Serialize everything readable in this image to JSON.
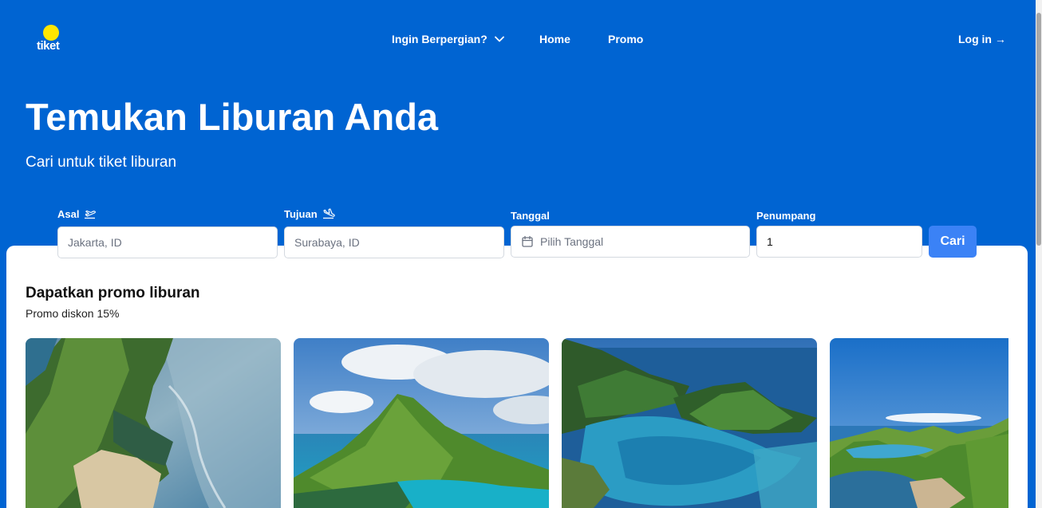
{
  "header": {
    "logo_text": "tiket",
    "nav": {
      "dropdown_label": "Ingin Berpergian?",
      "home_label": "Home",
      "promo_label": "Promo"
    },
    "login_label": "Log in →"
  },
  "hero": {
    "title": "Temukan Liburan Anda",
    "subtitle": "Cari untuk tiket liburan"
  },
  "search": {
    "asal": {
      "label": "Asal",
      "placeholder": "Jakarta, ID",
      "icon": "plane-takeoff-icon"
    },
    "tujuan": {
      "label": "Tujuan",
      "placeholder": "Surabaya, ID",
      "icon": "plane-landing-icon"
    },
    "tanggal": {
      "label": "Tanggal",
      "placeholder": "Pilih Tanggal",
      "icon": "calendar-icon"
    },
    "penumpang": {
      "label": "Penumpang",
      "value": "1"
    },
    "submit_label": "Cari"
  },
  "promo": {
    "title": "Dapatkan promo liburan",
    "subtitle": "Promo diskon 15%",
    "cards": [
      {
        "image": "coastal-cliff-photo"
      },
      {
        "image": "volcano-island-photo"
      },
      {
        "image": "lagoon-islands-photo"
      },
      {
        "image": "hills-bay-photo"
      }
    ]
  },
  "colors": {
    "brand_blue": "#0064d2",
    "logo_yellow": "#ffe600",
    "button_blue": "#3b82f6"
  }
}
